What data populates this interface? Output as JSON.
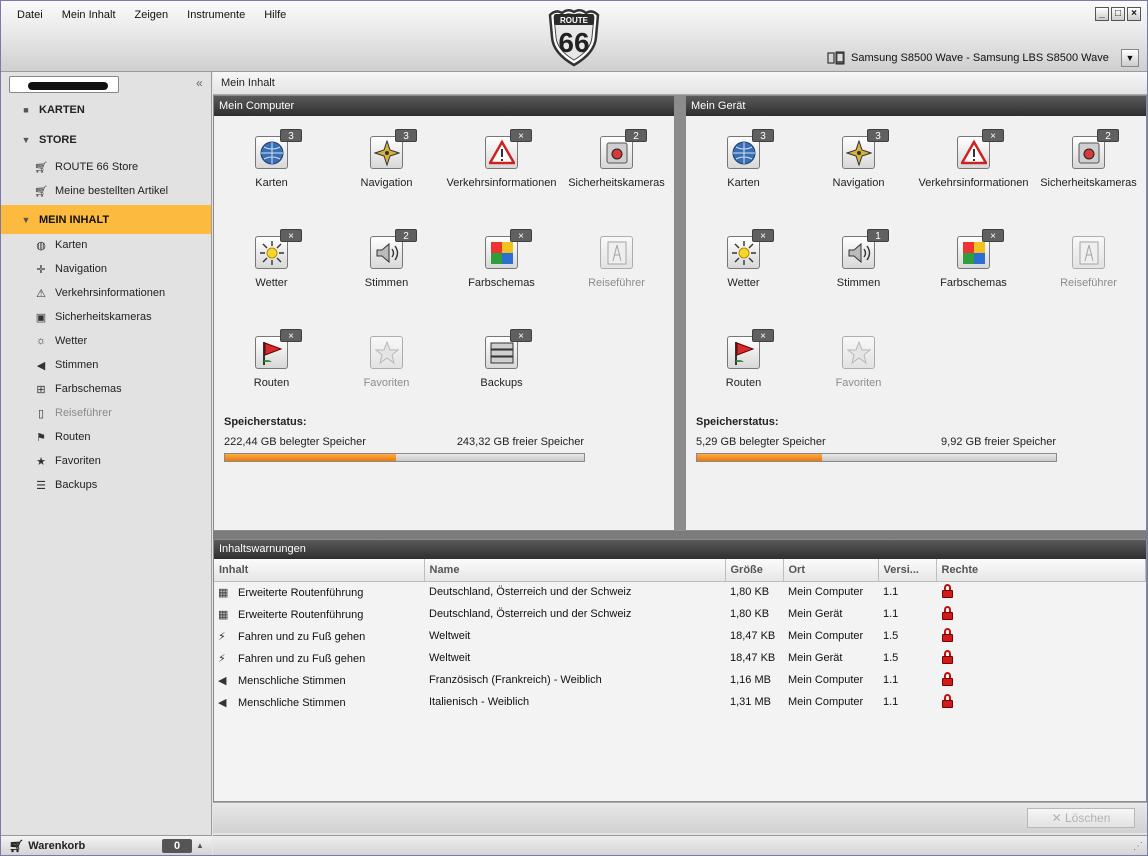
{
  "menu": [
    "Datei",
    "Mein Inhalt",
    "Zeigen",
    "Instrumente",
    "Hilfe"
  ],
  "logo": {
    "top": "ROUTE",
    "number": "66"
  },
  "window_buttons": [
    "_",
    "□",
    "×"
  ],
  "device": {
    "selected": "Samsung S8500 Wave - Samsung LBS S8500 Wave"
  },
  "sidebar": {
    "sections": [
      {
        "label": "KARTEN",
        "marker": "■"
      },
      {
        "label": "STORE",
        "marker": "▼"
      },
      {
        "label": "MEIN INHALT",
        "marker": "▼"
      }
    ],
    "store_items": [
      "ROUTE 66 Store",
      "Meine bestellten Artikel"
    ],
    "content_items": [
      "Karten",
      "Navigation",
      "Verkehrsinformationen",
      "Sicherheitskameras",
      "Wetter",
      "Stimmen",
      "Farbschemas",
      "Reiseführer",
      "Routen",
      "Favoriten",
      "Backups"
    ],
    "cart_label": "Warenkorb",
    "cart_count": "0"
  },
  "breadcrumb": "Mein Inhalt",
  "computer": {
    "title": "Mein Computer",
    "tiles": [
      {
        "label": "Karten",
        "badge": "3"
      },
      {
        "label": "Navigation",
        "badge": "3"
      },
      {
        "label": "Verkehrsinformationen",
        "badge": "×"
      },
      {
        "label": "Sicherheitskameras",
        "badge": "2"
      },
      {
        "label": "Wetter",
        "badge": "×"
      },
      {
        "label": "Stimmen",
        "badge": "2"
      },
      {
        "label": "Farbschemas",
        "badge": "×"
      },
      {
        "label": "Reiseführer",
        "badge": ""
      },
      {
        "label": "Routen",
        "badge": "×"
      },
      {
        "label": "Favoriten",
        "badge": ""
      },
      {
        "label": "Backups",
        "badge": "×"
      }
    ],
    "storage_title": "Speicherstatus:",
    "used": "222,44 GB belegter Speicher",
    "free": "243,32 GB freier Speicher",
    "used_fraction": 0.477
  },
  "device_panel": {
    "title": "Mein Gerät",
    "tiles": [
      {
        "label": "Karten",
        "badge": "3"
      },
      {
        "label": "Navigation",
        "badge": "3"
      },
      {
        "label": "Verkehrsinformationen",
        "badge": "×"
      },
      {
        "label": "Sicherheitskameras",
        "badge": "2"
      },
      {
        "label": "Wetter",
        "badge": "×"
      },
      {
        "label": "Stimmen",
        "badge": "1"
      },
      {
        "label": "Farbschemas",
        "badge": "×"
      },
      {
        "label": "Reiseführer",
        "badge": ""
      },
      {
        "label": "Routen",
        "badge": "×"
      },
      {
        "label": "Favoriten",
        "badge": ""
      }
    ],
    "storage_title": "Speicherstatus:",
    "used": "5,29 GB belegter Speicher",
    "free": "9,92 GB freier Speicher",
    "used_fraction": 0.348
  },
  "warnings": {
    "title": "Inhaltswarnungen",
    "columns": [
      "Inhalt",
      "Name",
      "Größe",
      "Ort",
      "Versi...",
      "Rechte"
    ],
    "rows": [
      [
        "Erweiterte Routenführung",
        "Deutschland, Österreich und der Schweiz",
        "1,80 KB",
        "Mein Computer",
        "1.1"
      ],
      [
        "Erweiterte Routenführung",
        "Deutschland, Österreich und der Schweiz",
        "1,80 KB",
        "Mein Gerät",
        "1.1"
      ],
      [
        "Fahren und zu Fuß gehen",
        "Weltweit",
        "18,47 KB",
        "Mein Computer",
        "1.5"
      ],
      [
        "Fahren und zu Fuß gehen",
        "Weltweit",
        "18,47 KB",
        "Mein Gerät",
        "1.5"
      ],
      [
        "Menschliche Stimmen",
        "Französisch (Frankreich) - Weiblich",
        "1,16 MB",
        "Mein Computer",
        "1.1"
      ],
      [
        "Menschliche Stimmen",
        "Italienisch - Weiblich",
        "1,31 MB",
        "Mein Computer",
        "1.1"
      ]
    ],
    "delete_label": "Löschen"
  }
}
